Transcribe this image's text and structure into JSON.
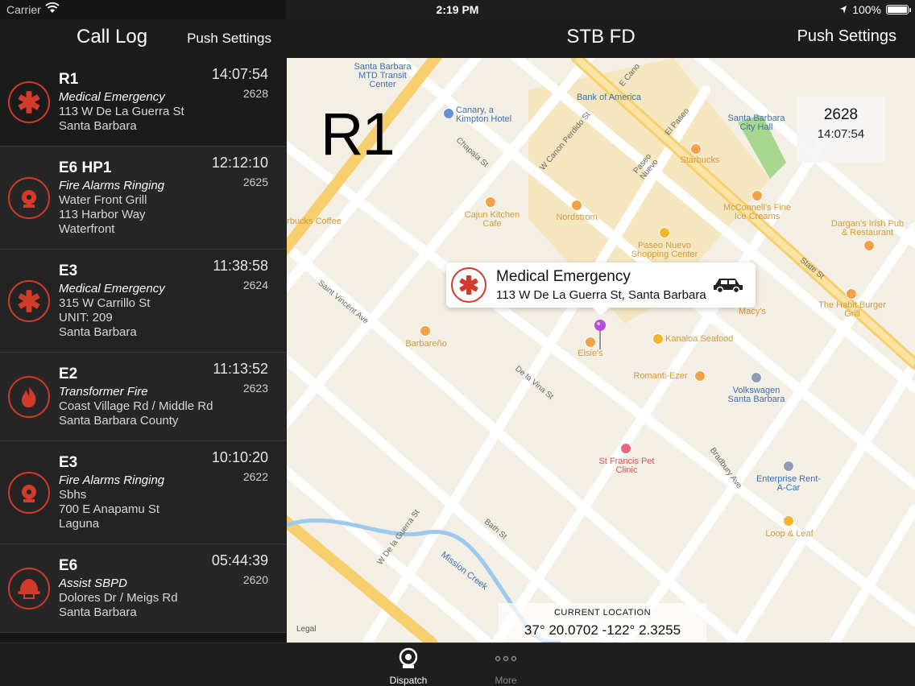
{
  "status_bar": {
    "carrier": "Carrier",
    "time": "2:19 PM",
    "battery": "100%"
  },
  "left_nav": {
    "title": "Call Log",
    "push_settings": "Push Settings"
  },
  "right_nav": {
    "title": "STB FD",
    "push_settings": "Push Settings"
  },
  "calls": [
    {
      "unit": "R1",
      "type": "Medical Emergency",
      "lines": [
        "113 W De La Guerra St",
        "Santa Barbara"
      ],
      "time": "14:07:54",
      "number": "2628",
      "icon": "medical-star-icon"
    },
    {
      "unit": "E6 HP1",
      "type": "Fire Alarms Ringing",
      "lines": [
        "Water Front Grill",
        "113 Harbor Way",
        "Waterfront"
      ],
      "time": "12:12:10",
      "number": "2625",
      "icon": "fire-alarm-bell-icon"
    },
    {
      "unit": "E3",
      "type": "Medical Emergency",
      "lines": [
        "315 W Carrillo St",
        "UNIT: 209",
        "Santa Barbara"
      ],
      "time": "11:38:58",
      "number": "2624",
      "icon": "medical-star-icon"
    },
    {
      "unit": "E2",
      "type": "Transformer Fire",
      "lines": [
        "Coast Village Rd / Middle Rd",
        "Santa Barbara County"
      ],
      "time": "11:13:52",
      "number": "2623",
      "icon": "flame-icon"
    },
    {
      "unit": "E3",
      "type": "Fire Alarms Ringing",
      "lines": [
        "Sbhs",
        "700 E Anapamu St",
        "Laguna"
      ],
      "time": "10:10:20",
      "number": "2622",
      "icon": "fire-alarm-bell-icon"
    },
    {
      "unit": "E6",
      "type": "Assist SBPD",
      "lines": [
        "Dolores Dr / Meigs Rd",
        "Santa Barbara"
      ],
      "time": "05:44:39",
      "number": "2620",
      "icon": "firefighter-helmet-icon"
    }
  ],
  "map": {
    "unit_overlay": "R1",
    "info_box": {
      "number": "2628",
      "time": "14:07:54"
    },
    "callout": {
      "title": "Medical Emergency",
      "address": "113 W De La Guerra St, Santa Barbara"
    },
    "current_location": {
      "label": "CURRENT LOCATION",
      "coords": "37° 20.0702  -122° 2.3255"
    },
    "legal": "Legal",
    "labels": {
      "mtd": "Santa Barbara MTD Transit Center",
      "canary": "Canary, a Kimpton Hotel",
      "boa_top": "Bank of America",
      "city_hall": "Santa Barbara City Hall",
      "starbucks": "Starbucks",
      "cajun": "Cajun Kitchen Cafe",
      "nordstrom": "Nordstrom",
      "mcconnells": "McConnell's Fine Ice Creams",
      "dargans": "Dargan's Irish Pub & Restaurant",
      "paseo": "Paseo Nuevo Shopping Center",
      "macys": "Macy's",
      "habit": "The Habit Burger Grill",
      "barbareno": "Barbareño",
      "elsies": "Elsie's",
      "kanaloa": "Kanaloa Seafood",
      "romanti": "Romanti-Ezer",
      "vw": "Volkswagen Santa Barbara",
      "st_francis": "St Francis Pet Clinic",
      "enterprise": "Enterprise Rent-A-Car",
      "loop_leaf": "Loop & Leaf",
      "bucks_coffee": "rbucks Coffee",
      "state_st": "State St",
      "de_la_vina": "De la Vina St",
      "chapala": "Chapala St",
      "mission_creek": "Mission Creek",
      "paseo_nuevo": "Paseo Nuevo",
      "el_paseo": "El Paseo",
      "saint_vincent": "Saint Vincent Ave",
      "bath": "Bath St",
      "w_de_la_guerra": "W De la Guerra St",
      "bradbury": "Bradbury Ave",
      "w_canon": "W Canon Perdido St",
      "e_cano": "E Cano"
    }
  },
  "tabs": [
    {
      "label": "Dispatch",
      "icon": "dispatch-bell-icon",
      "active": true
    },
    {
      "label": "More",
      "icon": "more-dots-icon",
      "active": false
    }
  ]
}
